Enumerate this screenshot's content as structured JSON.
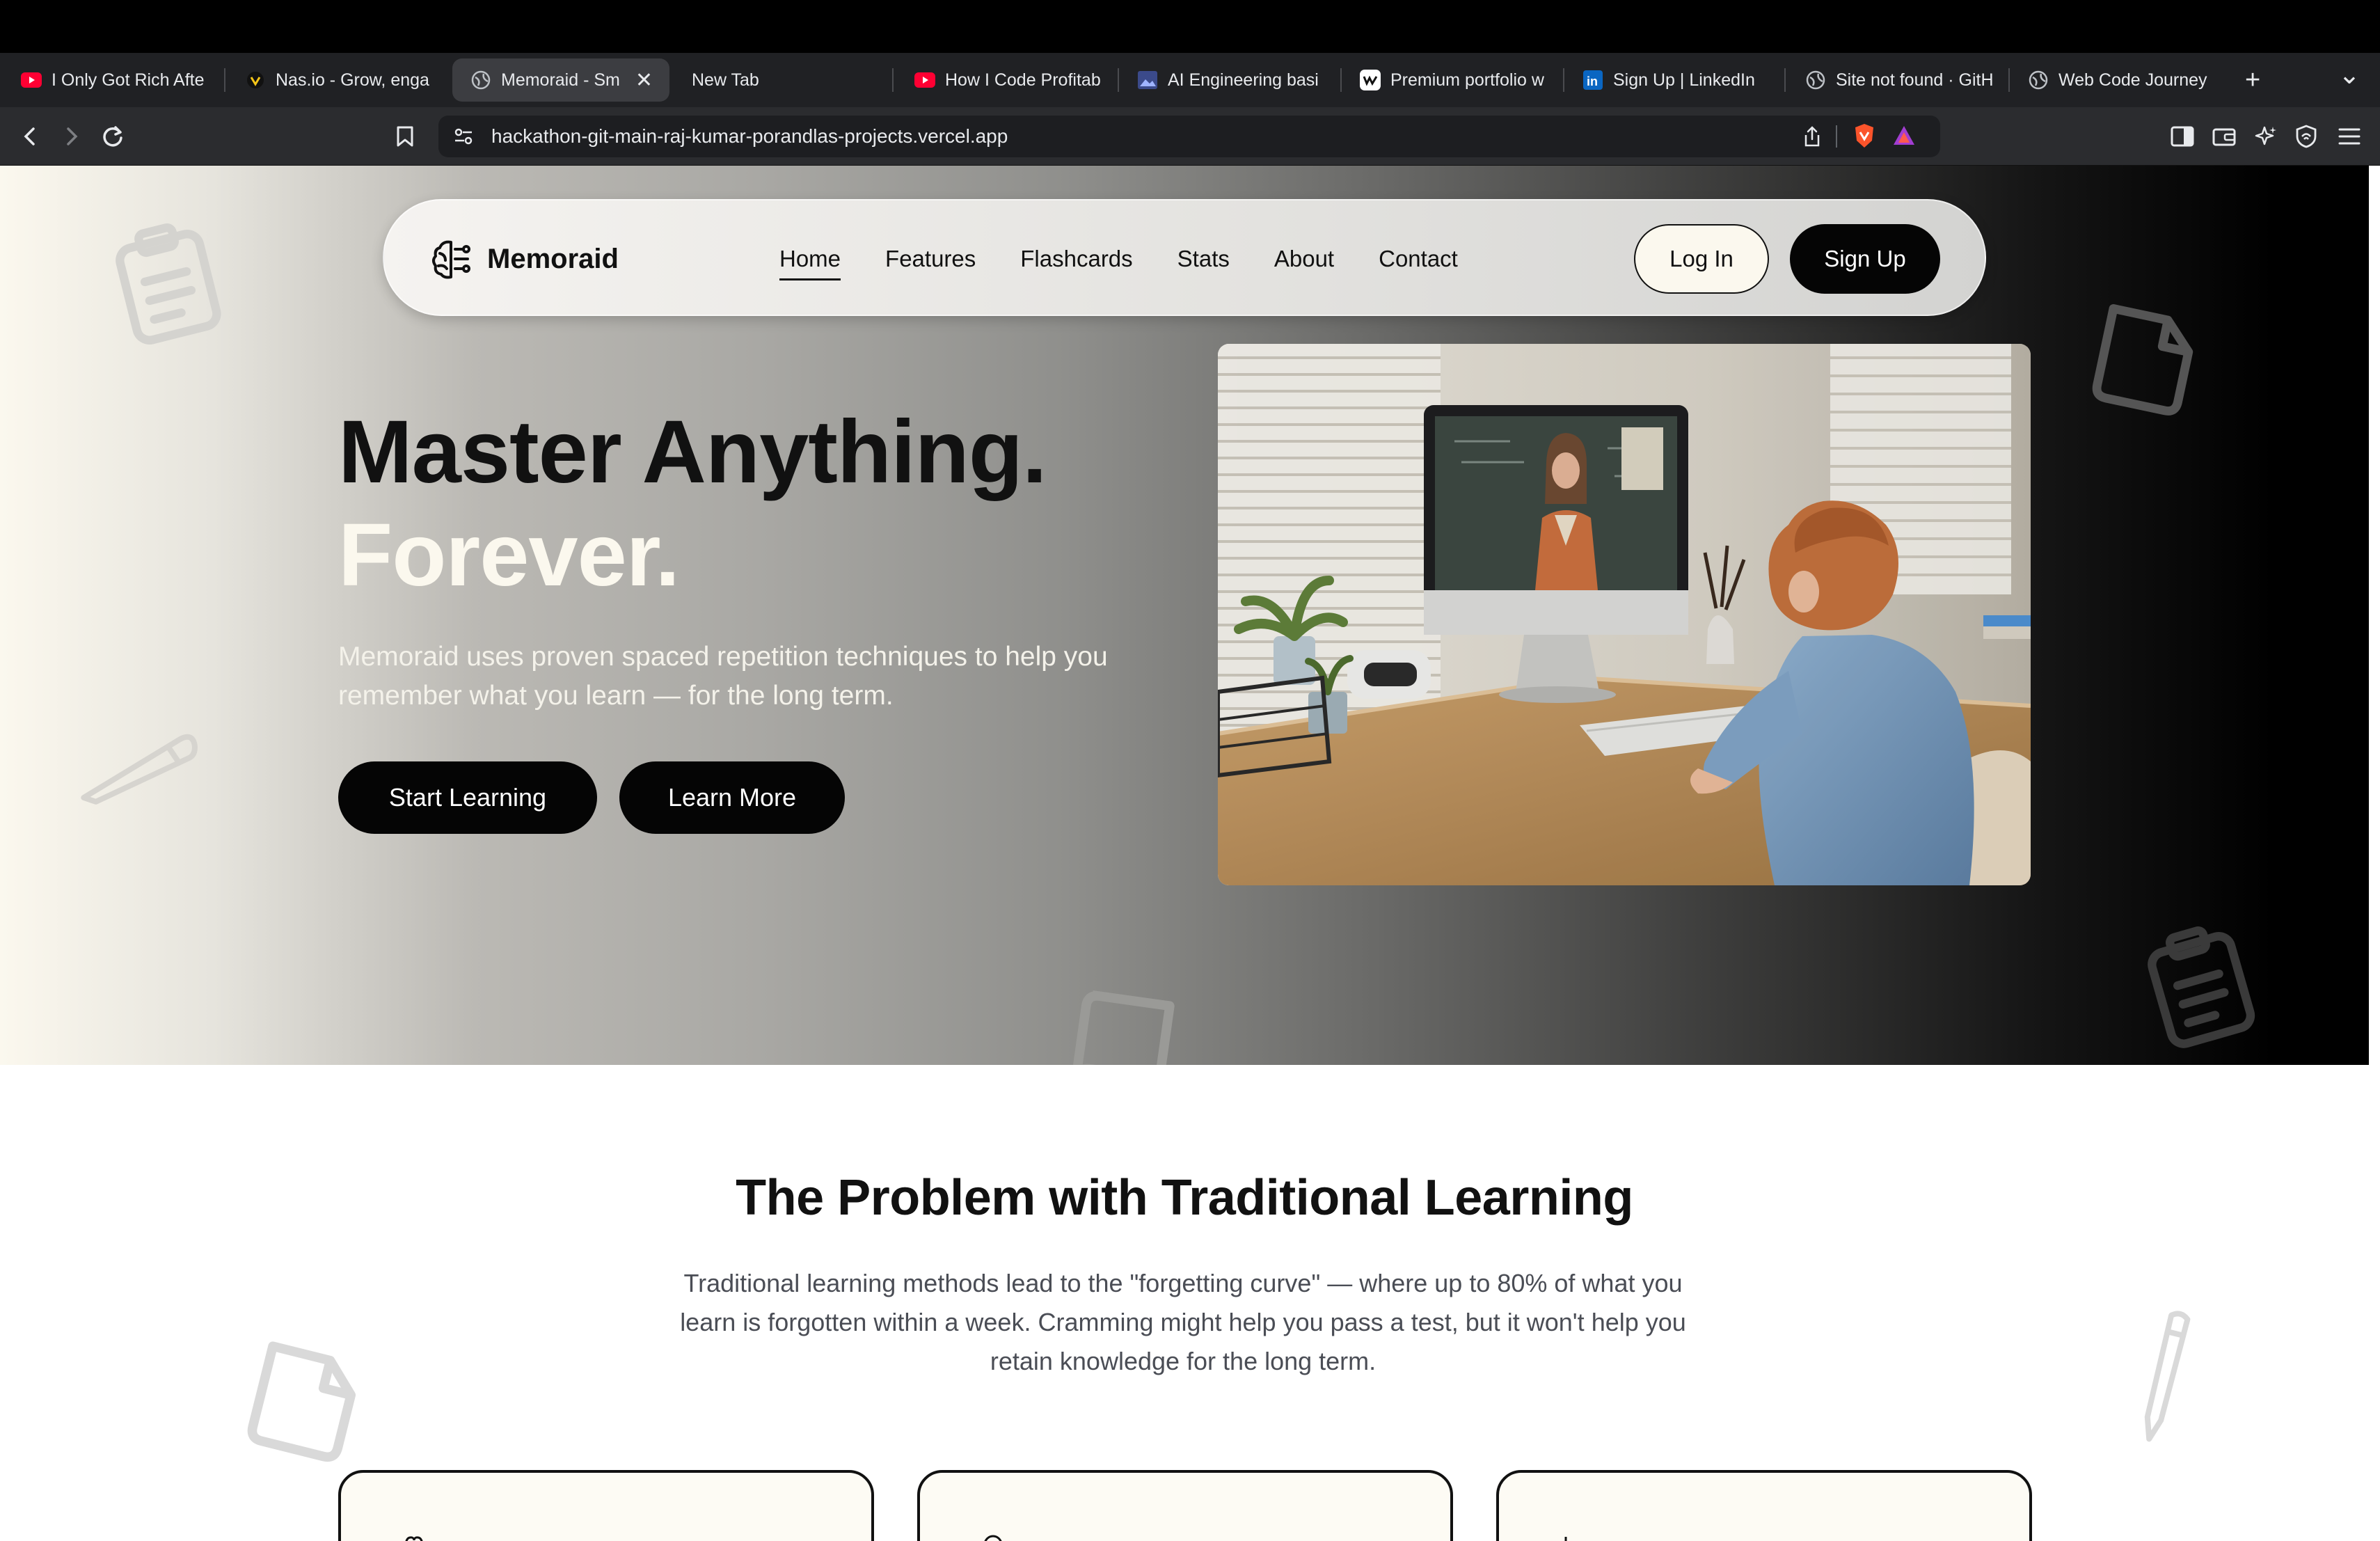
{
  "browser": {
    "tabs": [
      {
        "title": "I Only Got Rich Afte",
        "favicon": "youtube-icon",
        "active": false
      },
      {
        "title": "Nas.io - Grow, enga",
        "favicon": "nas-icon",
        "active": false
      },
      {
        "title": "Memoraid - Sm",
        "favicon": "globe-icon",
        "active": true
      },
      {
        "title": "New Tab",
        "favicon": "",
        "active": false
      },
      {
        "title": "How I Code Profitab",
        "favicon": "youtube-icon",
        "active": false
      },
      {
        "title": "AI Engineering basi",
        "favicon": "image-icon",
        "active": false
      },
      {
        "title": "Premium portfolio w",
        "favicon": "webflow-icon",
        "active": false
      },
      {
        "title": "Sign Up | LinkedIn",
        "favicon": "linkedin-icon",
        "active": false
      },
      {
        "title": "Site not found · GitH",
        "favicon": "globe-icon",
        "active": false
      },
      {
        "title": "Web Code Journey",
        "favicon": "globe-icon",
        "active": false
      }
    ],
    "url": "hackathon-git-main-raj-kumar-porandlas-projects.vercel.app",
    "close_glyph": "✕",
    "new_tab_glyph": "+",
    "tab_menu_glyph": "⌄"
  },
  "nav": {
    "brand": "Memoraid",
    "links": [
      "Home",
      "Features",
      "Flashcards",
      "Stats",
      "About",
      "Contact"
    ],
    "active_link": "Home",
    "login": "Log In",
    "signup": "Sign Up"
  },
  "hero": {
    "headline_line1": "Master Anything.",
    "headline_line2": "Forever.",
    "subtext": "Memoraid uses proven spaced repetition techniques to help you remember what you learn — for the long term.",
    "cta_primary": "Start Learning",
    "cta_secondary": "Learn More"
  },
  "problem": {
    "title": "The Problem with Traditional Learning",
    "text": "Traditional learning methods lead to the \"forgetting curve\" — where up to 80% of what you learn is forgotten within a week. Cramming might help you pass a test, but it won't help you retain knowledge for the long term."
  },
  "colors": {
    "accent": "#050505",
    "cream": "#fbf8ee",
    "chrome_dark": "#202124"
  }
}
